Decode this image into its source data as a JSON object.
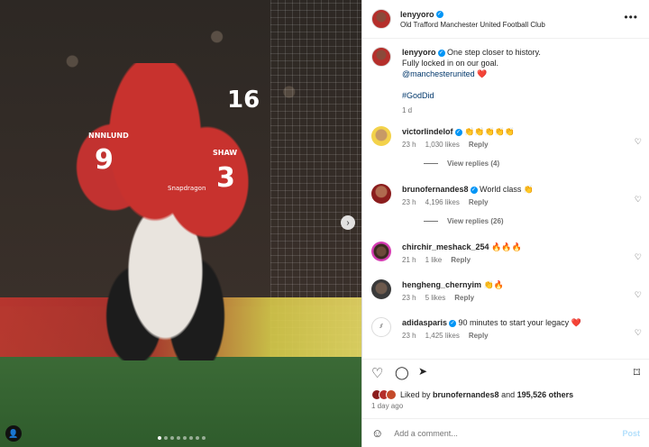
{
  "post": {
    "username": "lenyyoro",
    "location": "Old Trafford Manchester United Football Club",
    "more_label": "•••"
  },
  "photo": {
    "jersey_numbers": [
      "16",
      "9",
      "3"
    ],
    "jersey_names": [
      "NNNLUND",
      "SHAW"
    ],
    "sponsor": "Snapdragon",
    "next_label": "›",
    "user_tag_label": "👤",
    "slide_count": 8,
    "active_slide": 1
  },
  "caption": {
    "username": "lenyyoro",
    "line1": "One step closer to history.",
    "line2": "Fully locked in on our goal.",
    "mention": "@manchesterunited",
    "emoji": "❤️",
    "hashtag": "#GodDid",
    "time": "1 d"
  },
  "comments": [
    {
      "username": "victorlindelof",
      "verified": true,
      "text": "👏👏👏👏👏",
      "time": "23 h",
      "likes": "1,030 likes",
      "reply": "Reply",
      "view_replies": "View replies (4)"
    },
    {
      "username": "brunofernandes8",
      "verified": true,
      "text": "World class 👏",
      "time": "23 h",
      "likes": "4,196 likes",
      "reply": "Reply",
      "view_replies": "View replies (26)"
    },
    {
      "username": "chirchir_meshack_254",
      "verified": false,
      "text": "🔥🔥🔥",
      "time": "21 h",
      "likes": "1 like",
      "reply": "Reply"
    },
    {
      "username": "hengheng_chernyim",
      "verified": false,
      "text": "👏🔥",
      "time": "23 h",
      "likes": "5 likes",
      "reply": "Reply"
    },
    {
      "username": "adidasparis",
      "verified": true,
      "text": "90 minutes to start your legacy ❤️",
      "time": "23 h",
      "likes": "1,425 likes",
      "reply": "Reply"
    }
  ],
  "actions": {
    "like_icon": "♡",
    "comment_icon": "◯",
    "share_icon": "➤",
    "save_icon": "⌑"
  },
  "likes": {
    "prefix": "Liked by",
    "user": "brunofernandes8",
    "middle": "and",
    "count": "195,526 others"
  },
  "date": "1 day ago",
  "comment_box": {
    "emoji_icon": "☺",
    "placeholder": "Add a comment...",
    "post_label": "Post"
  },
  "heart_icon": "♡",
  "verified_glyph": "✓"
}
